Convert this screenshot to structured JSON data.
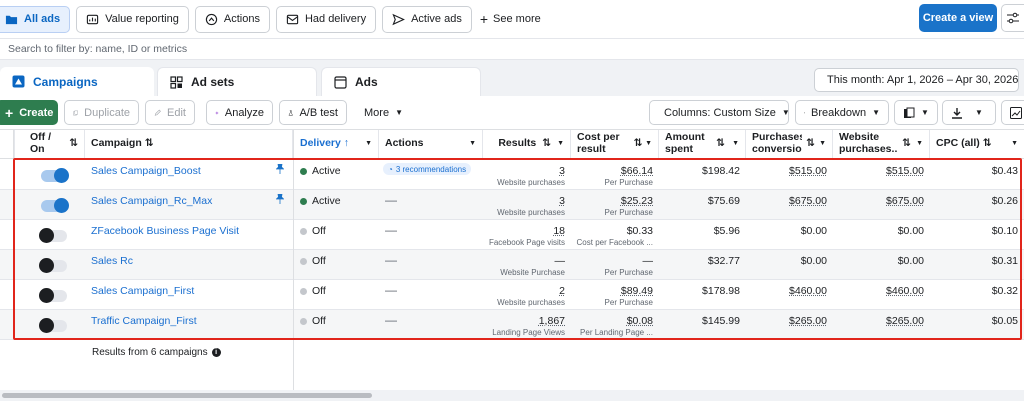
{
  "filter_chips": [
    {
      "label": "All ads",
      "icon": "folder-icon",
      "active": true
    },
    {
      "label": "Value reporting",
      "icon": "value-icon",
      "active": false
    },
    {
      "label": "Actions",
      "icon": "actions-icon",
      "active": false
    },
    {
      "label": "Had delivery",
      "icon": "inbox-icon",
      "active": false
    },
    {
      "label": "Active ads",
      "icon": "send-icon",
      "active": false
    }
  ],
  "see_more": "See more",
  "create_view": "Create a view",
  "search_placeholder": "Search to filter by: name, ID or metrics",
  "tabs": {
    "campaigns": "Campaigns",
    "ad_sets": "Ad sets",
    "ads": "Ads"
  },
  "date_range": "This month: Apr 1, 2026 – Apr 30, 2026",
  "toolbar": {
    "create": "Create",
    "duplicate": "Duplicate",
    "edit": "Edit",
    "analyze": "Analyze",
    "ab_test": "A/B test",
    "more": "More",
    "columns": "Columns: Custom Size",
    "breakdown": "Breakdown"
  },
  "headers": {
    "off_on": "Off / On",
    "campaign": "Campaign",
    "delivery": "Delivery",
    "actions": "Actions",
    "results": "Results",
    "cost_per_result": "Cost per result",
    "amount_spent": "Amount spent",
    "purchases_conversion": "Purchases conversio...",
    "website_purchases": "Website purchases...",
    "cpc": "CPC (all)"
  },
  "rows": [
    {
      "on": true,
      "pinned": true,
      "campaign": "Sales Campaign_Boost",
      "delivery": "Active",
      "action": "3 recommendations",
      "results": "3",
      "results_label": "Website purchases",
      "cost": "$66.14",
      "cost_label": "Per Purchase",
      "spent": "$198.42",
      "purch": "$515.00",
      "web": "$515.00",
      "cpc": "$0.43"
    },
    {
      "on": true,
      "pinned": true,
      "campaign": "Sales Campaign_Rc_Max",
      "delivery": "Active",
      "action": "—",
      "results": "3",
      "results_label": "Website purchases",
      "cost": "$25.23",
      "cost_label": "Per Purchase",
      "spent": "$75.69",
      "purch": "$675.00",
      "web": "$675.00",
      "cpc": "$0.26"
    },
    {
      "on": false,
      "pinned": false,
      "campaign": "ZFacebook Business Page Visit",
      "delivery": "Off",
      "action": "—",
      "results": "18",
      "results_label": "Facebook Page visits",
      "cost": "$0.33",
      "cost_label": "Cost per Facebook ...",
      "spent": "$5.96",
      "purch": "$0.00",
      "web": "$0.00",
      "cpc": "$0.10"
    },
    {
      "on": false,
      "pinned": false,
      "campaign": "Sales Rc",
      "delivery": "Off",
      "action": "—",
      "results": "—",
      "results_label": "Website Purchase",
      "cost": "—",
      "cost_label": "Per Purchase",
      "spent": "$32.77",
      "purch": "$0.00",
      "web": "$0.00",
      "cpc": "$0.31"
    },
    {
      "on": false,
      "pinned": false,
      "campaign": "Sales Campaign_First",
      "delivery": "Off",
      "action": "—",
      "results": "2",
      "results_label": "Website purchases",
      "cost": "$89.49",
      "cost_label": "Per Purchase",
      "spent": "$178.98",
      "purch": "$460.00",
      "web": "$460.00",
      "cpc": "$0.32"
    },
    {
      "on": false,
      "pinned": false,
      "campaign": "Traffic Campaign_First",
      "delivery": "Off",
      "action": "—",
      "results": "1,867",
      "results_label": "Landing Page Views",
      "cost": "$0.08",
      "cost_label": "Per Landing Page ...",
      "spent": "$145.99",
      "purch": "$265.00",
      "web": "$265.00",
      "cpc": "$0.05"
    }
  ],
  "footer": "Results from 6 campaigns",
  "colors": {
    "accent": "#1a73c9",
    "create": "#2e7d4f",
    "active_dot": "#2e7d4f",
    "off_dot": "#c4c7cc",
    "highlight": "#e1251b"
  }
}
